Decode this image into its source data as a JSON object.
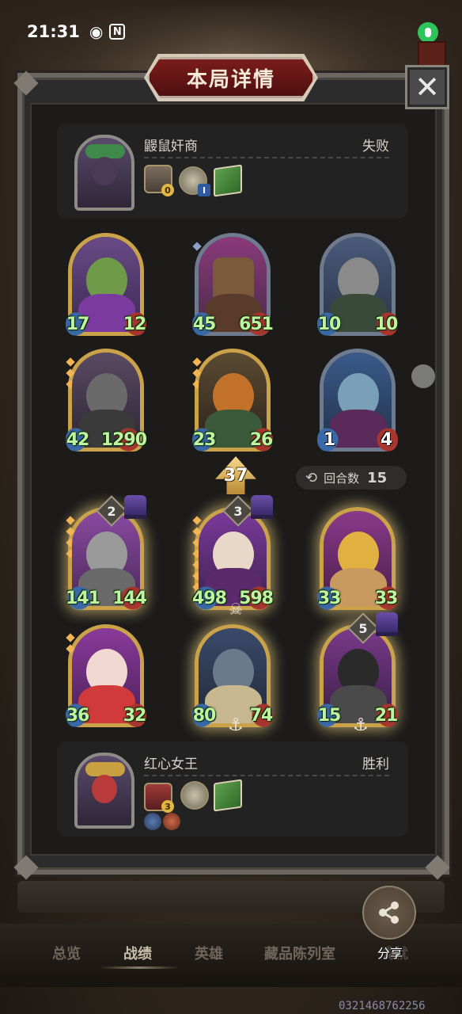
{
  "status_bar": {
    "time": "21:31"
  },
  "title": "本局详情",
  "close_glyph": "✕",
  "players": {
    "top": {
      "name": "鼹鼠奸商",
      "result": "失败",
      "item_badge": "0",
      "medal_badge": "I"
    },
    "bottom": {
      "name": "红心女王",
      "result": "胜利",
      "item_badge": "3"
    }
  },
  "opponent_minions": [
    {
      "atk": "17",
      "hp": "12"
    },
    {
      "atk": "45",
      "hp": "651"
    },
    {
      "atk": "10",
      "hp": "10"
    },
    {
      "atk": "42",
      "hp": "1290"
    },
    {
      "atk": "23",
      "hp": "26"
    },
    {
      "atk": "1",
      "hp": "4"
    }
  ],
  "player_minions": [
    {
      "atk": "141",
      "hp": "144",
      "tier": "2"
    },
    {
      "atk": "498",
      "hp": "598",
      "tier": "3"
    },
    {
      "atk": "33",
      "hp": "33"
    },
    {
      "atk": "36",
      "hp": "32"
    },
    {
      "atk": "80",
      "hp": "74"
    },
    {
      "atk": "15",
      "hp": "21",
      "tier": "5"
    }
  ],
  "attack_value": "37",
  "round": {
    "label": "回合数",
    "value": "15"
  },
  "share_label": "分享",
  "nav": {
    "overview": "总览",
    "records": "战绩",
    "heroes": "英雄",
    "collection": "藏品陈列室",
    "other": "成就"
  },
  "watermark": "0321468762256",
  "colors": {
    "gold_frame": "#caa24a",
    "silver_frame": "#6e7a8e",
    "stat_text": "#bff3a0",
    "title_red": "#7a1d1a"
  },
  "icons": [
    "eye-icon",
    "nfc-icon",
    "mic-icon",
    "close-icon",
    "share-icon",
    "refresh-icon",
    "anchor-icon",
    "skull-icon"
  ]
}
